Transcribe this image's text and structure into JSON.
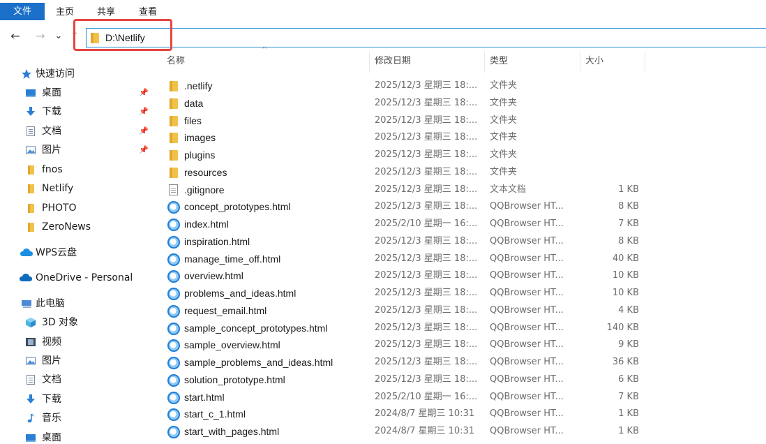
{
  "ribbon": {
    "tabs": [
      "文件",
      "主页",
      "共享",
      "查看"
    ]
  },
  "nav": {
    "back": "←",
    "forward": "→",
    "recent": "⌄",
    "up": "↑"
  },
  "address": {
    "path": "D:\\Netlify"
  },
  "sidebar": {
    "quick_access": "快速访问",
    "quick_items": [
      {
        "label": "桌面",
        "icon": "desktop-icon"
      },
      {
        "label": "下载",
        "icon": "download-icon"
      },
      {
        "label": "文档",
        "icon": "document-icon"
      },
      {
        "label": "图片",
        "icon": "picture-icon"
      },
      {
        "label": "fnos",
        "icon": "folder-icon"
      },
      {
        "label": "Netlify",
        "icon": "folder-icon"
      },
      {
        "label": "PHOTO",
        "icon": "folder-icon"
      },
      {
        "label": "ZeroNews",
        "icon": "folder-icon"
      }
    ],
    "wps": "WPS云盘",
    "onedrive": "OneDrive - Personal",
    "this_pc": "此电脑",
    "pc_items": [
      {
        "label": "3D 对象",
        "icon": "3d-objects-icon"
      },
      {
        "label": "视频",
        "icon": "video-icon"
      },
      {
        "label": "图片",
        "icon": "picture-icon"
      },
      {
        "label": "文档",
        "icon": "document-icon"
      },
      {
        "label": "下载",
        "icon": "download-icon"
      },
      {
        "label": "音乐",
        "icon": "music-icon"
      },
      {
        "label": "桌面",
        "icon": "desktop-icon"
      }
    ]
  },
  "columns": {
    "name": "名称",
    "date": "修改日期",
    "type": "类型",
    "size": "大小"
  },
  "files": [
    {
      "name": ".netlify",
      "date": "2025/12/3 星期三 18:...",
      "type": "文件夹",
      "size": "",
      "icon": "folder-icon"
    },
    {
      "name": "data",
      "date": "2025/12/3 星期三 18:...",
      "type": "文件夹",
      "size": "",
      "icon": "folder-icon"
    },
    {
      "name": "files",
      "date": "2025/12/3 星期三 18:...",
      "type": "文件夹",
      "size": "",
      "icon": "folder-icon"
    },
    {
      "name": "images",
      "date": "2025/12/3 星期三 18:...",
      "type": "文件夹",
      "size": "",
      "icon": "folder-icon"
    },
    {
      "name": "plugins",
      "date": "2025/12/3 星期三 18:...",
      "type": "文件夹",
      "size": "",
      "icon": "folder-icon"
    },
    {
      "name": "resources",
      "date": "2025/12/3 星期三 18:...",
      "type": "文件夹",
      "size": "",
      "icon": "folder-icon"
    },
    {
      "name": ".gitignore",
      "date": "2025/12/3 星期三 18:...",
      "type": "文本文档",
      "size": "1 KB",
      "icon": "text-file-icon"
    },
    {
      "name": "concept_prototypes.html",
      "date": "2025/12/3 星期三 18:...",
      "type": "QQBrowser HT...",
      "size": "8 KB",
      "icon": "browser-html-icon"
    },
    {
      "name": "index.html",
      "date": "2025/2/10 星期一 16:...",
      "type": "QQBrowser HT...",
      "size": "7 KB",
      "icon": "browser-html-icon"
    },
    {
      "name": "inspiration.html",
      "date": "2025/12/3 星期三 18:...",
      "type": "QQBrowser HT...",
      "size": "8 KB",
      "icon": "browser-html-icon"
    },
    {
      "name": "manage_time_off.html",
      "date": "2025/12/3 星期三 18:...",
      "type": "QQBrowser HT...",
      "size": "40 KB",
      "icon": "browser-html-icon"
    },
    {
      "name": "overview.html",
      "date": "2025/12/3 星期三 18:...",
      "type": "QQBrowser HT...",
      "size": "10 KB",
      "icon": "browser-html-icon"
    },
    {
      "name": "problems_and_ideas.html",
      "date": "2025/12/3 星期三 18:...",
      "type": "QQBrowser HT...",
      "size": "10 KB",
      "icon": "browser-html-icon"
    },
    {
      "name": "request_email.html",
      "date": "2025/12/3 星期三 18:...",
      "type": "QQBrowser HT...",
      "size": "4 KB",
      "icon": "browser-html-icon"
    },
    {
      "name": "sample_concept_prototypes.html",
      "date": "2025/12/3 星期三 18:...",
      "type": "QQBrowser HT...",
      "size": "140 KB",
      "icon": "browser-html-icon"
    },
    {
      "name": "sample_overview.html",
      "date": "2025/12/3 星期三 18:...",
      "type": "QQBrowser HT...",
      "size": "9 KB",
      "icon": "browser-html-icon"
    },
    {
      "name": "sample_problems_and_ideas.html",
      "date": "2025/12/3 星期三 18:...",
      "type": "QQBrowser HT...",
      "size": "36 KB",
      "icon": "browser-html-icon"
    },
    {
      "name": "solution_prototype.html",
      "date": "2025/12/3 星期三 18:...",
      "type": "QQBrowser HT...",
      "size": "6 KB",
      "icon": "browser-html-icon"
    },
    {
      "name": "start.html",
      "date": "2025/2/10 星期一 16:...",
      "type": "QQBrowser HT...",
      "size": "7 KB",
      "icon": "browser-html-icon"
    },
    {
      "name": "start_c_1.html",
      "date": "2024/8/7 星期三 10:31",
      "type": "QQBrowser HT...",
      "size": "1 KB",
      "icon": "browser-html-icon"
    },
    {
      "name": "start_with_pages.html",
      "date": "2024/8/7 星期三 10:31",
      "type": "QQBrowser HT...",
      "size": "1 KB",
      "icon": "browser-html-icon"
    }
  ]
}
